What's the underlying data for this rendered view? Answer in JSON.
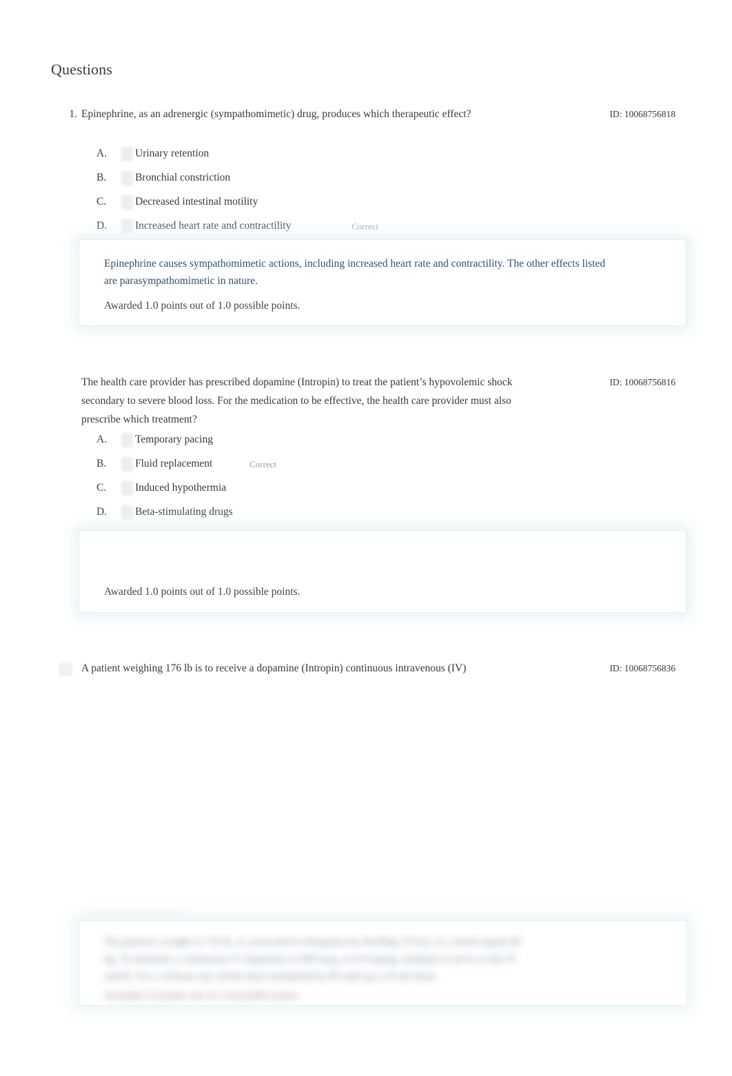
{
  "document": {
    "title": "Questions"
  },
  "questions": [
    {
      "number": "1.",
      "stem": "Epinephrine, as an adrenergic (sympathomimetic) drug, produces which therapeutic effect?",
      "id_label": "ID: 10068756818",
      "options": [
        {
          "letter": "A.",
          "text": "Urinary retention",
          "status": ""
        },
        {
          "letter": "B.",
          "text": "Bronchial constriction",
          "status": ""
        },
        {
          "letter": "C.",
          "text": "Decreased intestinal motility",
          "status": ""
        },
        {
          "letter": "D.",
          "text": "Increased heart rate and contractility",
          "status": "Correct"
        }
      ],
      "feedback": {
        "rationale": "Epinephrine causes sympathomimetic actions, including increased heart rate and contractility. The other effects listed are parasympathomimetic in nature.",
        "awarded": "Awarded 1.0 points out of 1.0 possible points."
      }
    },
    {
      "number": "",
      "stem": "The health care provider has prescribed dopamine (Intropin) to treat the patient’s hypovolemic shock secondary to severe blood loss. For the medication to be effective, the health care provider must also prescribe which treatment?",
      "id_label": "ID: 10068756816",
      "options": [
        {
          "letter": "A.",
          "text": "Temporary pacing",
          "status": ""
        },
        {
          "letter": "B.",
          "text": "Fluid replacement",
          "status": "Correct"
        },
        {
          "letter": "C.",
          "text": "Induced hypothermia",
          "status": ""
        },
        {
          "letter": "D.",
          "text": "Beta-stimulating drugs",
          "status": ""
        }
      ],
      "feedback": {
        "rationale": "",
        "awarded": "Awarded 1.0 points out of 1.0 possible points."
      }
    },
    {
      "number": "",
      "stem": "A patient weighing 176 lb is to receive a dopamine (Intropin) continuous intravenous (IV)",
      "id_label": "ID: 10068756836",
      "options": [],
      "feedback": {
        "rationale": "",
        "awarded": ""
      }
    }
  ],
  "obscured_feedback": {
    "line1": "The patient’s weight is 176 lb, or converted to kilograms by dividing 176 by 2.2, which equals 80",
    "line2": "kg. To maintain a continuous IV dopamine at 400 mcg, or 0.4 mg/kg, multiply to arrive at the IV",
    "line3": "rate/hr. For a 24 hour run, divide dose multiplied by 80 ends up a 20 mL/hour.",
    "awarded": "Awarded 1.0 points out of 1.0 possible points."
  },
  "colors": {
    "page_background": "#ffffff",
    "body_text": "#3a3a3a",
    "rationale_text": "#2e5170",
    "awarded_text": "#444444",
    "status_text": "#9d9d9d",
    "feedback_glow": "#e8f3f7"
  }
}
